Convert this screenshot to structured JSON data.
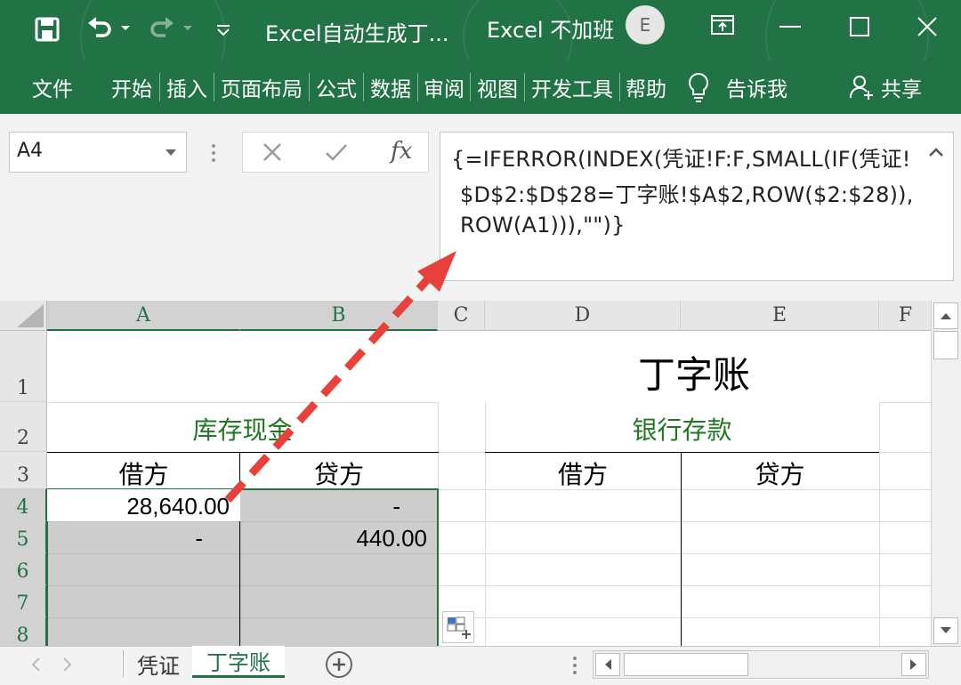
{
  "titlebar": {
    "document_title": "Excel自动生成丁...",
    "app_title": "Excel 不加班",
    "avatar_letter": "E"
  },
  "ribbon": {
    "tabs": [
      "文件",
      "开始",
      "插入",
      "页面布局",
      "公式",
      "数据",
      "审阅",
      "视图",
      "开发工具",
      "帮助"
    ],
    "tell_me": "告诉我",
    "share": "共享"
  },
  "formula_bar": {
    "name_box": "A4",
    "fx_label": "fx",
    "formula_lines": [
      "{=IFERROR(INDEX(凭证!F:F,SMALL(IF(凭证!",
      "$D$2:$D$28=丁字账!$A$2,ROW($2:$28)),",
      "ROW(A1))),\"\")}"
    ]
  },
  "grid": {
    "columns": [
      "A",
      "B",
      "C",
      "D",
      "E",
      "F"
    ],
    "rows": [
      "1",
      "2",
      "3",
      "4",
      "5",
      "6",
      "7",
      "8"
    ],
    "title": "丁字账",
    "cash_header": "库存现金",
    "bank_header": "银行存款",
    "debit": "借方",
    "credit": "贷方",
    "a4": "28,640.00",
    "b4": "-",
    "a5": "-",
    "b5": "440.00"
  },
  "sheets": {
    "tabs": [
      "凭证",
      "丁字账"
    ],
    "active": "丁字账"
  },
  "colors": {
    "excel_green": "#217346",
    "header_green": "#1f7a1f",
    "arrow_red": "#e8403a",
    "selection_gray": "#cdcdcd"
  }
}
